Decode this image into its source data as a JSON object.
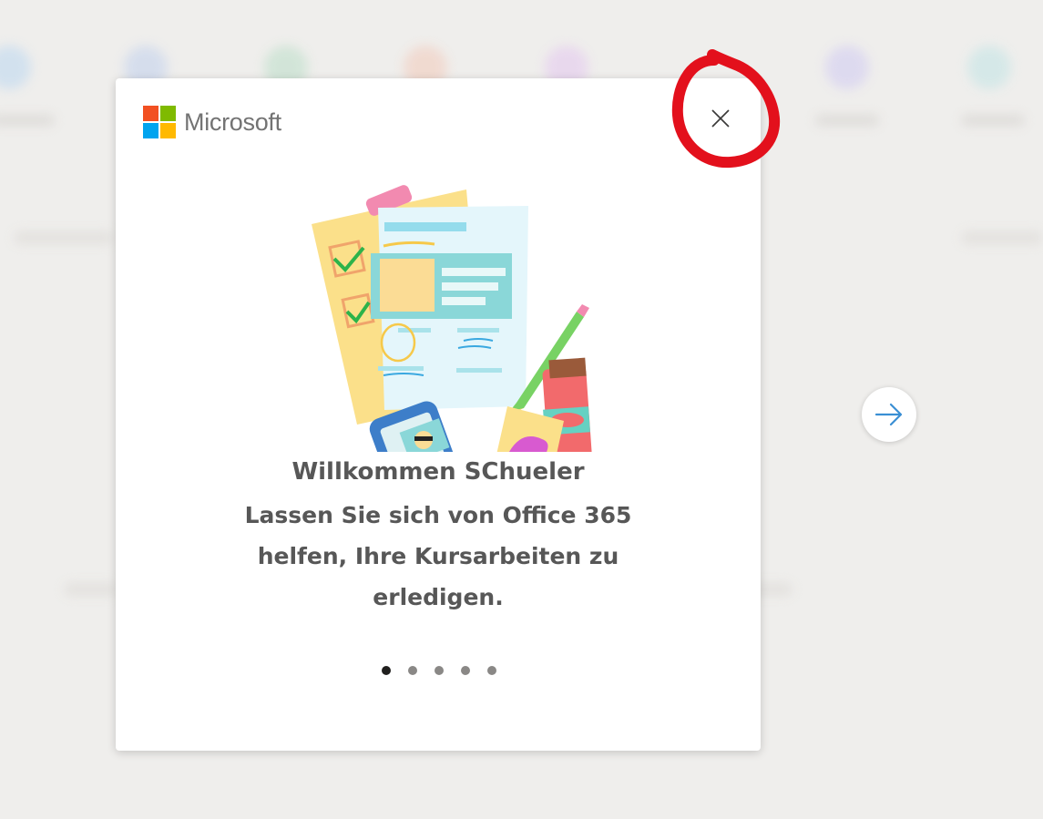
{
  "colors": {
    "ms_red": "#f25022",
    "ms_green": "#7fba00",
    "ms_blue": "#00a4ef",
    "ms_yellow": "#ffb900",
    "accent_blue": "#0078d4",
    "annotation_red": "#e3101c"
  },
  "modal": {
    "logo_text": "Microsoft",
    "close_icon": "close-icon",
    "title": "Willkommen SChueler",
    "body": "Lassen Sie sich von Office 365 helfen, Ihre Kursarbeiten zu erledigen.",
    "page_count": 5,
    "active_page": 1
  },
  "navigation": {
    "next_icon": "arrow-right-icon"
  },
  "annotation": {
    "shape": "red hand-drawn circle around close button"
  }
}
